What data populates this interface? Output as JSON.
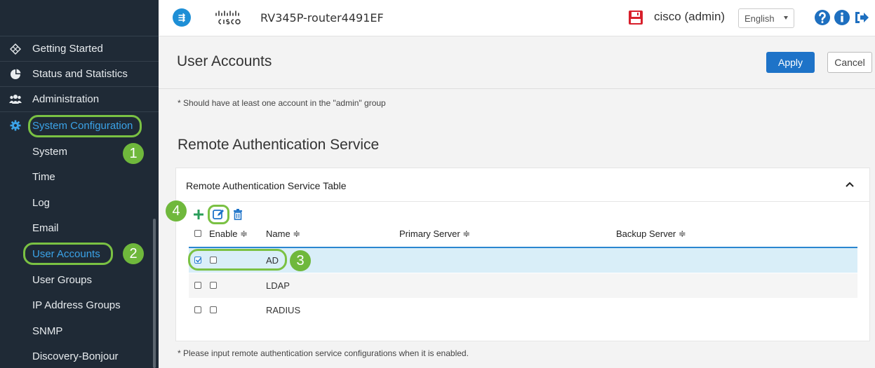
{
  "header": {
    "brand_glyph": "⇶",
    "device_name": "RV345P-router4491EF",
    "user_label": "cisco (admin)",
    "language": "English"
  },
  "sidebar": {
    "items": [
      {
        "label": "Getting Started",
        "icon": "compass-icon"
      },
      {
        "label": "Status and Statistics",
        "icon": "pie-chart-icon"
      },
      {
        "label": "Administration",
        "icon": "users-icon"
      },
      {
        "label": "System Configuration",
        "icon": "gear-icon"
      }
    ],
    "sub_items": [
      "System",
      "Time",
      "Log",
      "Email",
      "User Accounts",
      "User Groups",
      "IP Address Groups",
      "SNMP",
      "Discovery-Bonjour"
    ]
  },
  "annotations": {
    "badge1": "1",
    "badge2": "2",
    "badge3": "3",
    "badge4": "4"
  },
  "main": {
    "title": "User Accounts",
    "apply_label": "Apply",
    "cancel_label": "Cancel",
    "note_admin": "* Should have at least one account in the \"admin\" group",
    "section_title": "Remote Authentication Service",
    "panel_title": "Remote Authentication Service Table",
    "columns": [
      "Enable ≑",
      "Name ≑",
      "Primary Server ≑",
      "Backup Server ≑"
    ],
    "rows": [
      {
        "name": "AD",
        "selected": true
      },
      {
        "name": "LDAP",
        "selected": false
      },
      {
        "name": "RADIUS",
        "selected": false
      }
    ],
    "note_remote": "* Please input remote authentication service configurations when it is enabled."
  },
  "colors": {
    "sidebar_bg": "#1f2a36",
    "active_blue": "#3ba3e8",
    "highlight_green": "#7ac143",
    "apply_blue": "#1e73c8",
    "save_red": "#d8202c"
  }
}
